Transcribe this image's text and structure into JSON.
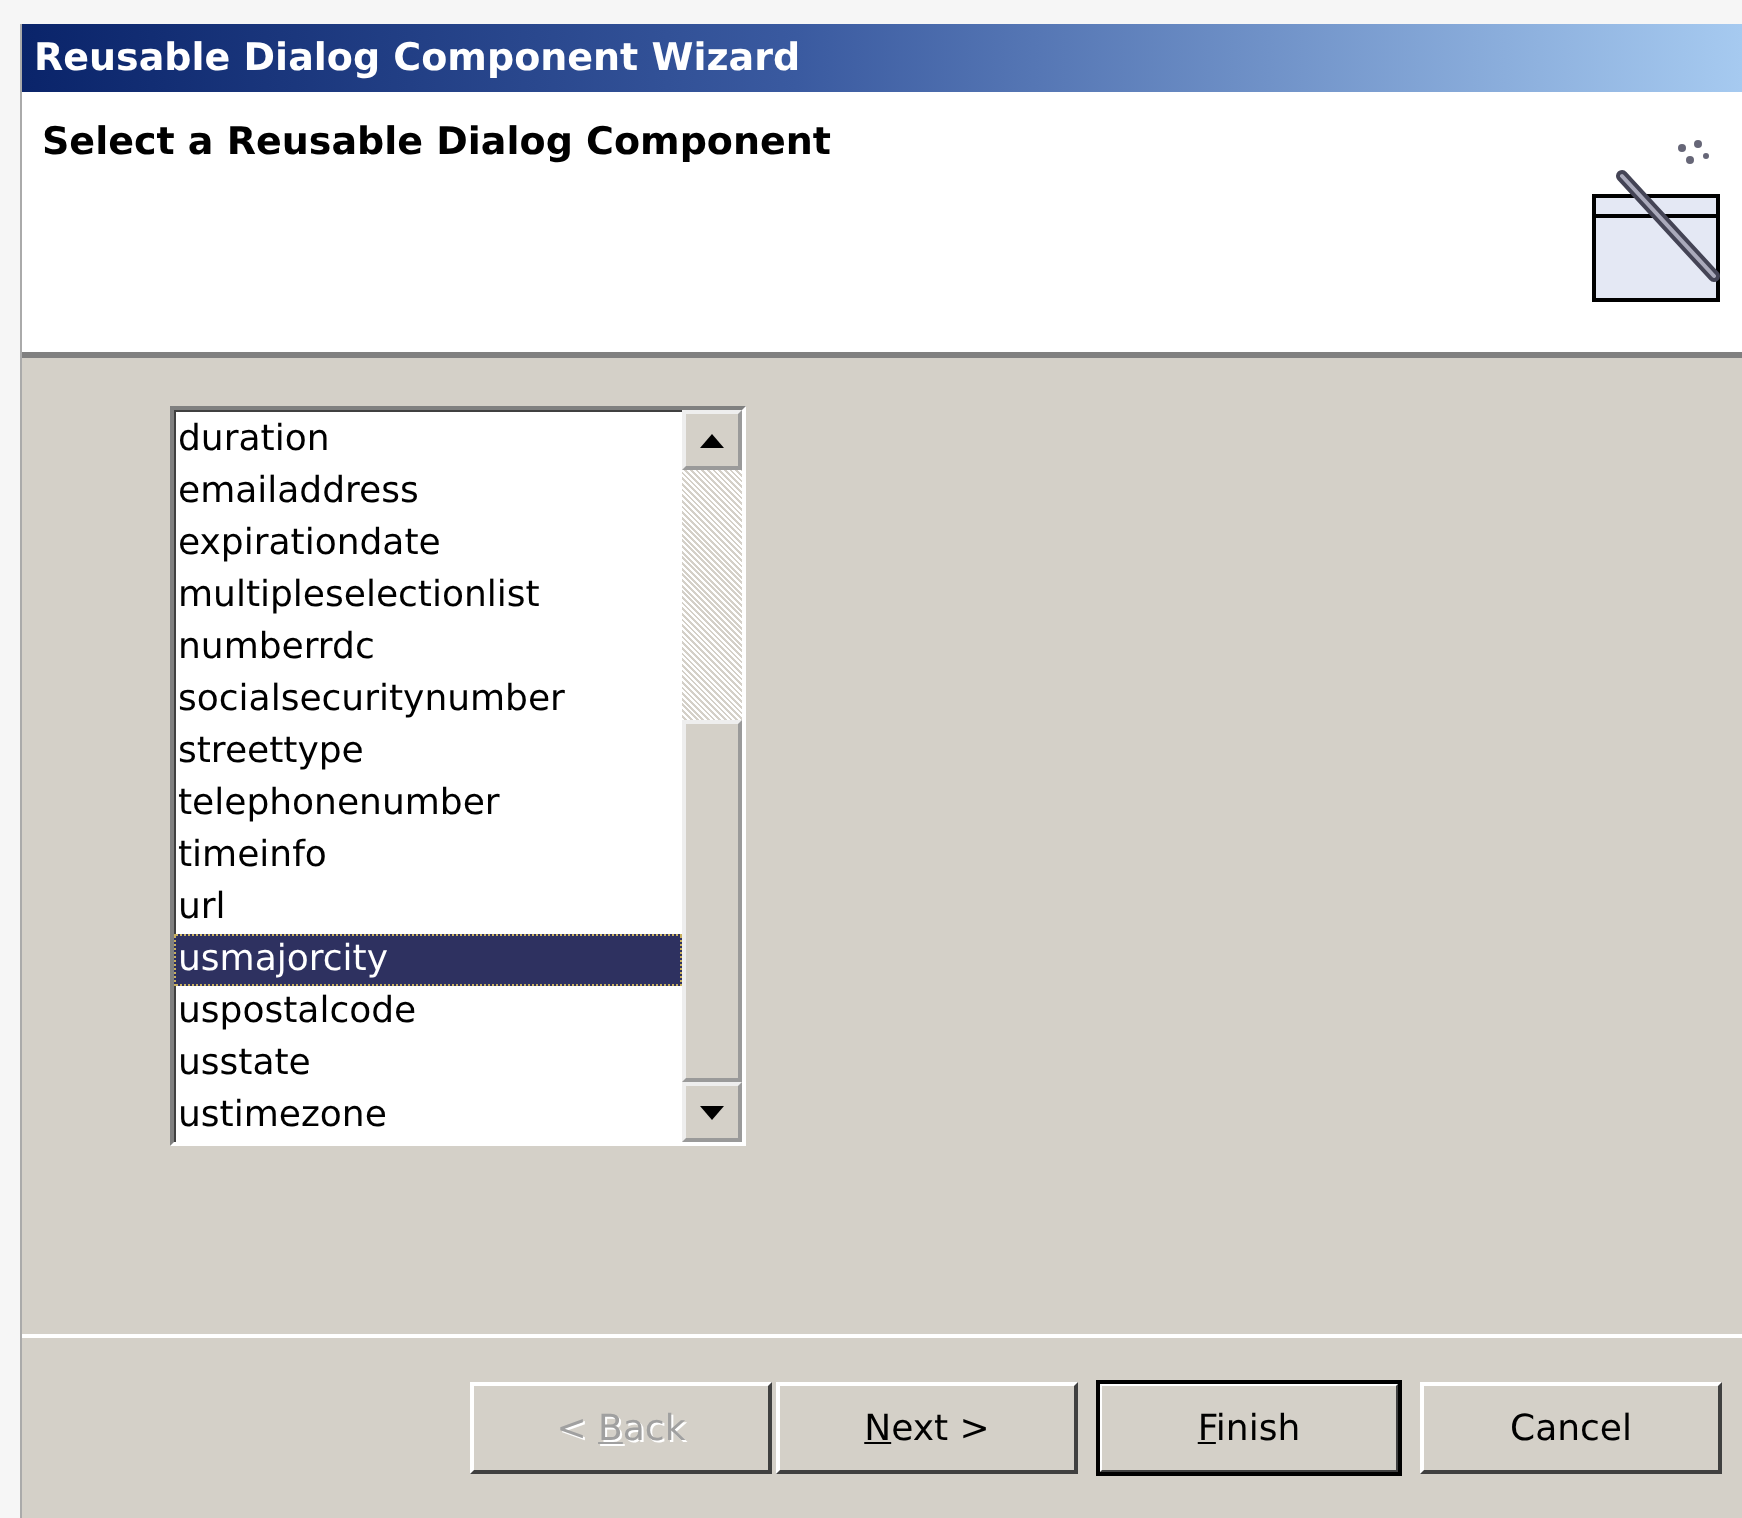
{
  "window": {
    "title": "Reusable Dialog Component Wizard"
  },
  "header": {
    "title": "Select a Reusable Dialog Component"
  },
  "list": {
    "items": [
      {
        "label": "duration",
        "selected": false
      },
      {
        "label": "emailaddress",
        "selected": false
      },
      {
        "label": "expirationdate",
        "selected": false
      },
      {
        "label": "multipleselectionlist",
        "selected": false
      },
      {
        "label": "numberrdc",
        "selected": false
      },
      {
        "label": "socialsecuritynumber",
        "selected": false
      },
      {
        "label": "streettype",
        "selected": false
      },
      {
        "label": "telephonenumber",
        "selected": false
      },
      {
        "label": "timeinfo",
        "selected": false
      },
      {
        "label": "url",
        "selected": false
      },
      {
        "label": "usmajorcity",
        "selected": true
      },
      {
        "label": "uspostalcode",
        "selected": false
      },
      {
        "label": "usstate",
        "selected": false
      },
      {
        "label": "ustimezone",
        "selected": false
      }
    ]
  },
  "buttons": [
    {
      "before": "< ",
      "mnemonic": "B",
      "after": "ack",
      "disabled": true,
      "default": false
    },
    {
      "mnemonic": "N",
      "after": "ext >",
      "disabled": false,
      "default": false
    },
    {
      "mnemonic": "F",
      "after": "inish",
      "disabled": false,
      "default": true
    },
    {
      "before": "Cancel",
      "disabled": false,
      "default": false
    }
  ]
}
